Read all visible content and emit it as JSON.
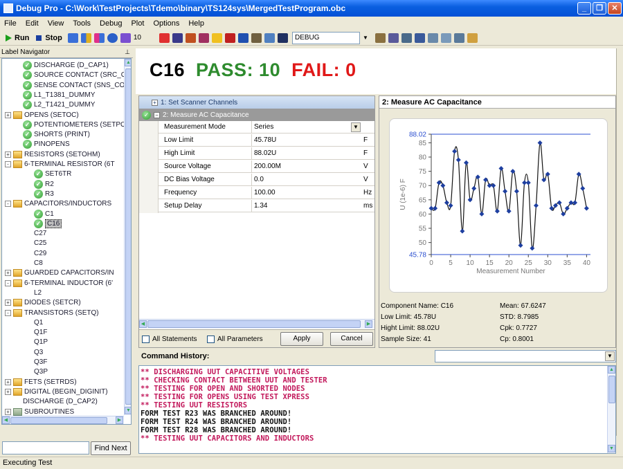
{
  "window": {
    "title": "Debug Pro - C:\\Work\\TestProjects\\Tdemo\\binary\\TS124sys\\MergedTestProgram.obc"
  },
  "menu": [
    "File",
    "Edit",
    "View",
    "Tools",
    "Debug",
    "Plot",
    "Options",
    "Help"
  ],
  "toolbar": {
    "run_label": "Run",
    "stop_label": "Stop",
    "step_count": "10",
    "mode": "DEBUG"
  },
  "navigator": {
    "header": "Label Navigator",
    "items": [
      {
        "label": "DISCHARGE (D_CAP1)",
        "icon": "check-icon",
        "indent": 2
      },
      {
        "label": "SOURCE CONTACT (SRC_C",
        "icon": "check-icon",
        "indent": 2
      },
      {
        "label": "SENSE CONTACT (SNS_COI",
        "icon": "check-icon",
        "indent": 2
      },
      {
        "label": "L1_T1381_DUMMY",
        "icon": "check-icon",
        "indent": 2
      },
      {
        "label": "L2_T1421_DUMMY",
        "icon": "check-icon",
        "indent": 2
      },
      {
        "label": "OPENS (SETOC)",
        "icon": "folder-icon",
        "indent": 1,
        "expand": "+"
      },
      {
        "label": "POTENTIOMETERS (SETPO'",
        "icon": "check-icon",
        "indent": 2
      },
      {
        "label": "SHORTS (PRINT)",
        "icon": "check-icon",
        "indent": 2
      },
      {
        "label": "PINOPENS",
        "icon": "check-icon",
        "indent": 2
      },
      {
        "label": "RESISTORS (SETOHM)",
        "icon": "folder-icon",
        "indent": 1,
        "expand": "+"
      },
      {
        "label": "6-TERMINAL RESISTOR (6T",
        "icon": "folder-icon",
        "indent": 1,
        "expand": "-"
      },
      {
        "label": "SET6TR",
        "icon": "check-icon",
        "indent": 3
      },
      {
        "label": "R2",
        "icon": "check-icon",
        "indent": 3
      },
      {
        "label": "R3",
        "icon": "check-icon",
        "indent": 3
      },
      {
        "label": "CAPACITORS/INDUCTORS",
        "icon": "folder-icon",
        "indent": 1,
        "expand": "-"
      },
      {
        "label": "C1",
        "icon": "check-icon",
        "indent": 3
      },
      {
        "label": "C16",
        "icon": "check-icon",
        "indent": 3,
        "selected": true
      },
      {
        "label": "C27",
        "icon": "",
        "indent": 3
      },
      {
        "label": "C25",
        "icon": "",
        "indent": 3
      },
      {
        "label": "C29",
        "icon": "",
        "indent": 3
      },
      {
        "label": "C8",
        "icon": "",
        "indent": 3
      },
      {
        "label": "GUARDED CAPACITORS/IN",
        "icon": "folder-icon",
        "indent": 1,
        "expand": "+"
      },
      {
        "label": "6-TERMINAL INDUCTOR (6'",
        "icon": "folder-icon",
        "indent": 1,
        "expand": "-"
      },
      {
        "label": "L2",
        "icon": "",
        "indent": 3
      },
      {
        "label": "DIODES (SETCR)",
        "icon": "folder-icon",
        "indent": 1,
        "expand": "+"
      },
      {
        "label": "TRANSISTORS (SETQ)",
        "icon": "folder-icon",
        "indent": 1,
        "expand": "-"
      },
      {
        "label": "Q1",
        "icon": "",
        "indent": 3
      },
      {
        "label": "Q1F",
        "icon": "",
        "indent": 3
      },
      {
        "label": "Q1P",
        "icon": "",
        "indent": 3
      },
      {
        "label": "Q3",
        "icon": "",
        "indent": 3
      },
      {
        "label": "Q3F",
        "icon": "",
        "indent": 3
      },
      {
        "label": "Q3P",
        "icon": "",
        "indent": 3
      },
      {
        "label": "FETS (SETRDS)",
        "icon": "folder-icon",
        "indent": 1,
        "expand": "+"
      },
      {
        "label": "DIGITAL (BEGIN_DIGINIT)",
        "icon": "folder-icon",
        "indent": 1,
        "expand": "+"
      },
      {
        "label": "DISCHARGE (D_CAP2)",
        "icon": "",
        "indent": 2
      },
      {
        "label": "SUBROUTINES",
        "icon": "folder-gray-icon",
        "indent": 1,
        "expand": "+"
      }
    ],
    "find_button": "Find Next",
    "find_value": ""
  },
  "banner": {
    "component": "C16",
    "pass": "PASS: 10",
    "fail": "FAIL: 0",
    "pass_color": "#2e8b2e",
    "fail_color": "#e01818"
  },
  "params": {
    "group1": "1: Set Scanner Channels",
    "group2": "2: Measure AC Capacitance",
    "rows": [
      {
        "label": "Measurement Mode",
        "value": "Series",
        "unit": ""
      },
      {
        "label": "Low Limit",
        "value": "45.78U",
        "unit": "F"
      },
      {
        "label": "High Limit",
        "value": "88.02U",
        "unit": "F"
      },
      {
        "label": "Source Voltage",
        "value": "200.00M",
        "unit": "V"
      },
      {
        "label": "DC Bias Voltage",
        "value": "0.0",
        "unit": "V"
      },
      {
        "label": "Frequency",
        "value": "100.00",
        "unit": "Hz"
      },
      {
        "label": "Setup Delay",
        "value": "1.34",
        "unit": "ms"
      }
    ],
    "all_statements": "All Statements",
    "all_parameters": "All Parameters",
    "apply": "Apply",
    "cancel": "Cancel"
  },
  "chart_panel": {
    "title": "2: Measure AC Capacitance",
    "stats": {
      "component": "Component Name:  C16",
      "low": "Low Limit:  45.78U",
      "high": "Hight Limit:  88.02U",
      "sample": "Sample Size:  41",
      "mean": "Mean: 67.6247",
      "std": "STD: 8.7985",
      "cpk": "Cpk: 0.7727",
      "cp": "Cp: 0.8001"
    }
  },
  "chart_data": {
    "type": "line",
    "xlabel": "Measurement Number",
    "ylabel": "U (1e-6) F",
    "xlim": [
      0,
      41
    ],
    "ylim": [
      45.78,
      88.02
    ],
    "xticks": [
      "0",
      "5",
      "10",
      "15",
      "20",
      "25",
      "30",
      "35",
      "40"
    ],
    "yticks": [
      "45.78",
      "50",
      "55",
      "60",
      "65",
      "70",
      "75",
      "80",
      "85",
      "88.02"
    ],
    "limit_lines": [
      45.78,
      88.02
    ],
    "x": [
      0,
      1,
      2,
      3,
      4,
      5,
      6,
      7,
      8,
      9,
      10,
      11,
      12,
      13,
      14,
      15,
      16,
      17,
      18,
      19,
      20,
      21,
      22,
      23,
      24,
      25,
      26,
      27,
      28,
      29,
      30,
      31,
      32,
      33,
      34,
      35,
      36,
      37,
      38,
      39,
      40
    ],
    "values": [
      62,
      62,
      71,
      70,
      64,
      63,
      82,
      79,
      54,
      78,
      65,
      69,
      73,
      60,
      72,
      70,
      70,
      61,
      76,
      68,
      61,
      75,
      68,
      49,
      71,
      71,
      48,
      63,
      85,
      72,
      74,
      62,
      63,
      64,
      60,
      62,
      64,
      64,
      74,
      69,
      62
    ],
    "color": "#1a237e",
    "marker_color": "#1e3fa0"
  },
  "command": {
    "label": "Command History:",
    "dropdown_value": "",
    "lines": [
      {
        "text": "** DISCHARGING UUT CAPACITIVE VOLTAGES",
        "color": "#c2185b"
      },
      {
        "text": "** CHECKING CONTACT BETWEEN UUT AND TESTER",
        "color": "#c2185b"
      },
      {
        "text": "** TESTING FOR OPEN AND SHORTED NODES",
        "color": "#c2185b"
      },
      {
        "text": "** TESTING FOR OPENS USING TEST XPRESS",
        "color": "#c2185b"
      },
      {
        "text": "** TESTING UUT RESISTORS",
        "color": "#c2185b"
      },
      {
        "text": "FORM TEST R23 WAS BRANCHED AROUND!",
        "color": "#111111"
      },
      {
        "text": "FORM TEST R24 WAS BRANCHED AROUND!",
        "color": "#111111"
      },
      {
        "text": "FORM TEST R28 WAS BRANCHED AROUND!",
        "color": "#111111"
      },
      {
        "text": "** TESTING UUT CAPACITORS AND INDUCTORS",
        "color": "#c2185b"
      }
    ]
  },
  "status": {
    "text": "Executing Test"
  }
}
